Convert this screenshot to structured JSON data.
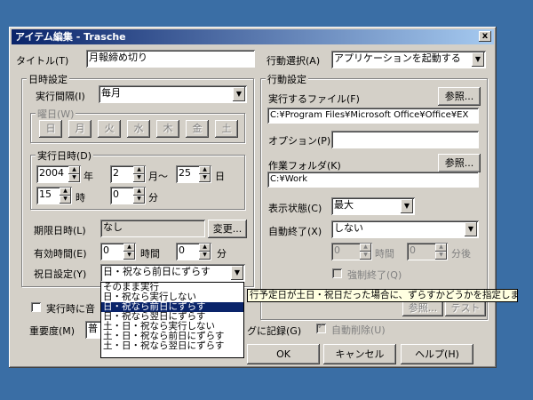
{
  "window": {
    "title": "アイテム編集 - Trasche",
    "close_glyph": "x"
  },
  "left": {
    "title_label": "タイトル(T)",
    "title_value": "月報締め切り",
    "schedule_group": "日時設定",
    "interval_label": "実行間隔(I)",
    "interval_value": "毎月",
    "weekday_group": "曜日(W)",
    "weekdays": [
      "日",
      "月",
      "火",
      "水",
      "木",
      "金",
      "土"
    ],
    "datetime_group": "実行日時(D)",
    "year_value": "2004",
    "year_unit": "年",
    "month_value": "2",
    "month_unit": "月〜",
    "day_value": "25",
    "day_unit": "日",
    "hour_value": "15",
    "hour_unit": "時",
    "minute_value": "0",
    "minute_unit": "分",
    "deadline_label": "期限日時(L)",
    "deadline_value": "なし",
    "change_button": "変更...",
    "valid_label": "有効時間(E)",
    "valid_hours_value": "0",
    "valid_hours_unit": "時間",
    "valid_minutes_value": "0",
    "valid_minutes_unit": "分",
    "holiday_label": "祝日設定(Y)",
    "holiday_value": "日・祝なら前日にずらす",
    "holiday_options": [
      "そのまま実行",
      "日・祝なら実行しない",
      "日・祝なら前日にずらす",
      "日・祝なら翌日にずらす",
      "土・日・祝なら実行しない",
      "土・日・祝なら前日にずらす",
      "土・日・祝なら翌日にずらす"
    ],
    "holiday_selected_index": 2,
    "sound_checkbox_label": "実行時に音",
    "importance_label": "重要度(M)",
    "importance_value": "普"
  },
  "right": {
    "action_label": "行動選択(A)",
    "action_value": "アプリケーションを起動する",
    "action_group": "行動設定",
    "file_label": "実行するファイル(F)",
    "file_browse": "参照...",
    "file_value": "C:¥Program Files¥Microsoft Office¥Office¥EX",
    "options_label": "オプション(P)",
    "options_value": "",
    "workdir_label": "作業フォルダ(K)",
    "workdir_browse": "参照...",
    "workdir_value": "C:¥Work",
    "display_label": "表示状態(C)",
    "display_value": "最大",
    "autoquit_label": "自動終了(X)",
    "autoquit_value": "しない",
    "aq_hours_value": "0",
    "aq_hours_unit": "時間",
    "aq_minutes_value": "0",
    "aq_minutes_unit": "分後",
    "force_quit_label": "強制終了(Q)",
    "browse3": "参照...",
    "test_button": "テスト",
    "log_label": "グに記録(G)",
    "auto_delete_label": "自動削除(U)"
  },
  "tooltip": "行予定日が土日・祝日だった場合に、ずらすかどうかを指定します",
  "footer": {
    "ok": "OK",
    "cancel": "キャンセル",
    "help": "ヘルプ(H)"
  }
}
